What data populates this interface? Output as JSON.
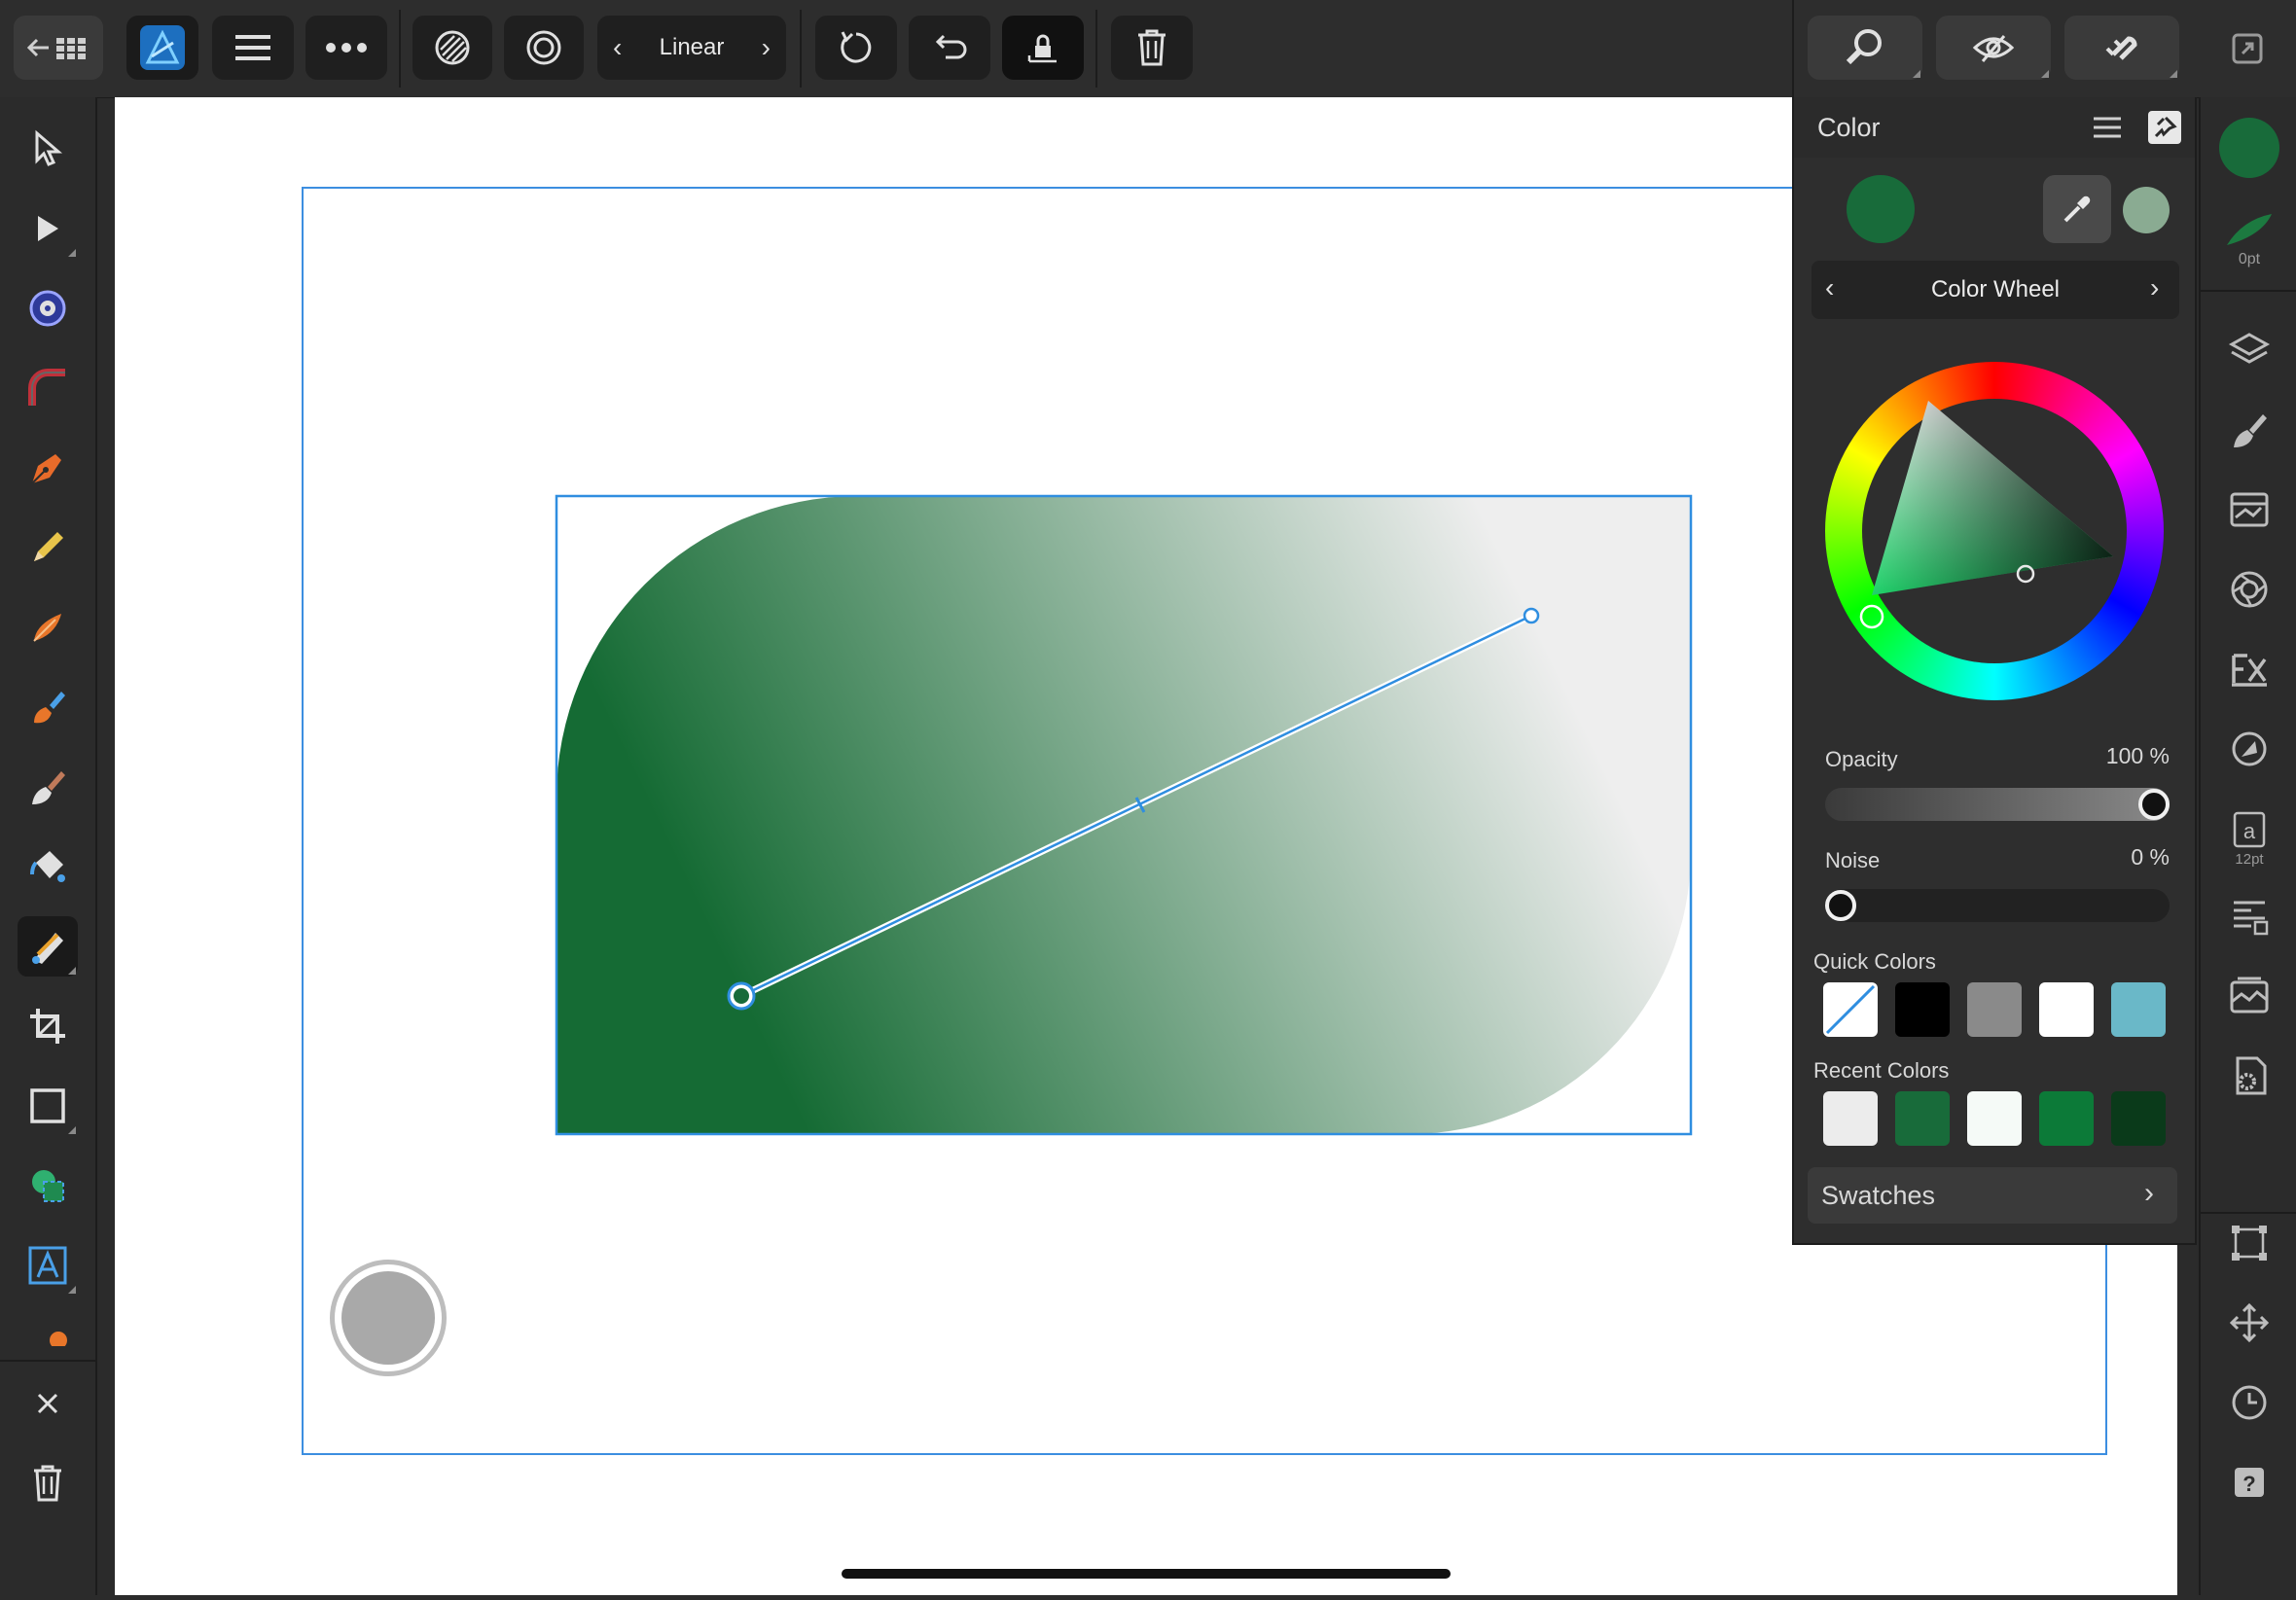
{
  "toolbar": {
    "gradient_type": "Linear",
    "colors": {
      "bg": "#2d2d2d",
      "button": "#1f1f1f",
      "accent": "#2f8ee0"
    }
  },
  "color_panel": {
    "title": "Color",
    "mode_label": "Color Wheel",
    "primary_color": "#186b3a",
    "secondary_color": "#8aab92",
    "opacity_label": "Opacity",
    "opacity_value": "100 %",
    "opacity_fraction": 1.0,
    "noise_label": "Noise",
    "noise_value": "0 %",
    "noise_fraction": 0.0,
    "quick_colors_label": "Quick Colors",
    "quick_colors": [
      "none",
      "#000000",
      "#8a8a8a",
      "#ffffff",
      "#6ab8c8"
    ],
    "recent_colors_label": "Recent Colors",
    "recent_colors": [
      "#ececec",
      "#186b3a",
      "#f5faf7",
      "#0c7a38",
      "#0a3a1a"
    ],
    "swatches_label": "Swatches"
  },
  "studio": {
    "stroke_width": "0pt",
    "text_size": "12pt",
    "fill_color": "#186b3a"
  },
  "shape": {
    "gradient_start": "#156b34",
    "gradient_end": "#eeeeee"
  }
}
